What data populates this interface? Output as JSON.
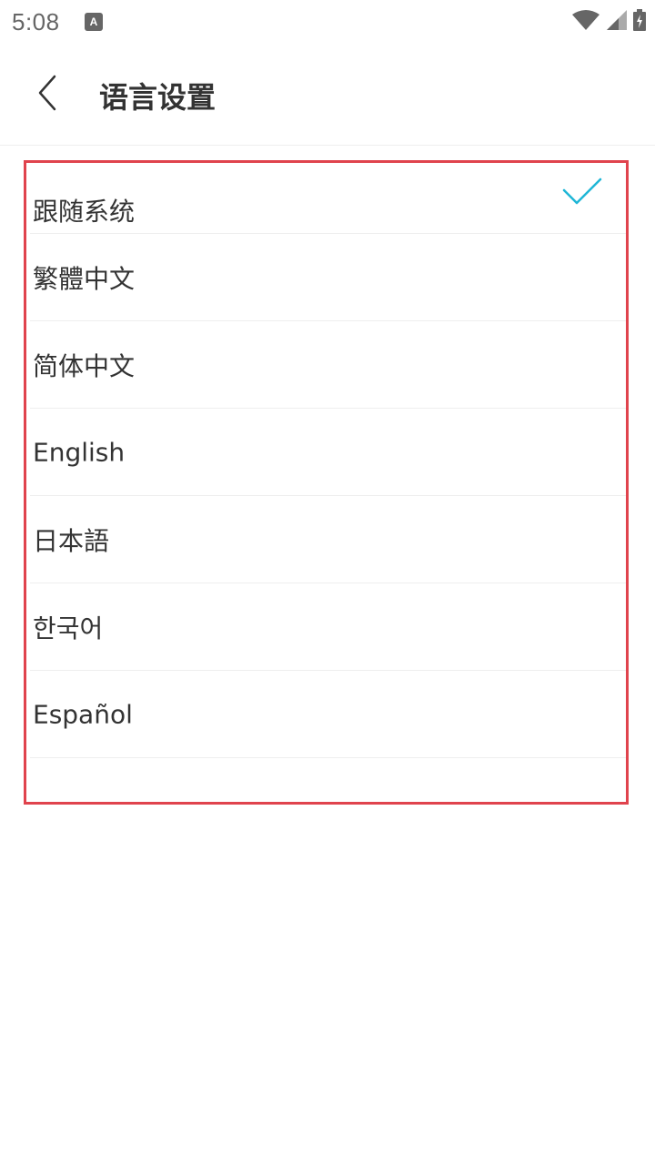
{
  "status_bar": {
    "time": "5:08",
    "app_icon_letter": "A",
    "icons": [
      "notification-app-icon",
      "wifi-icon",
      "signal-icon",
      "battery-charging-icon"
    ]
  },
  "toolbar": {
    "title": "语言设置",
    "back_icon": "chevron-left-icon"
  },
  "languages": {
    "items": [
      {
        "label": "跟随系统",
        "selected": true
      },
      {
        "label": "繁體中文",
        "selected": false
      },
      {
        "label": "简体中文",
        "selected": false
      },
      {
        "label": "English",
        "selected": false
      },
      {
        "label": "日本語",
        "selected": false
      },
      {
        "label": "한국어",
        "selected": false
      },
      {
        "label": "Español",
        "selected": false
      }
    ]
  },
  "colors": {
    "accent": "#1fb6d6",
    "highlight_border": "#e0434d",
    "text": "#333333",
    "divider": "#eeeeee"
  }
}
